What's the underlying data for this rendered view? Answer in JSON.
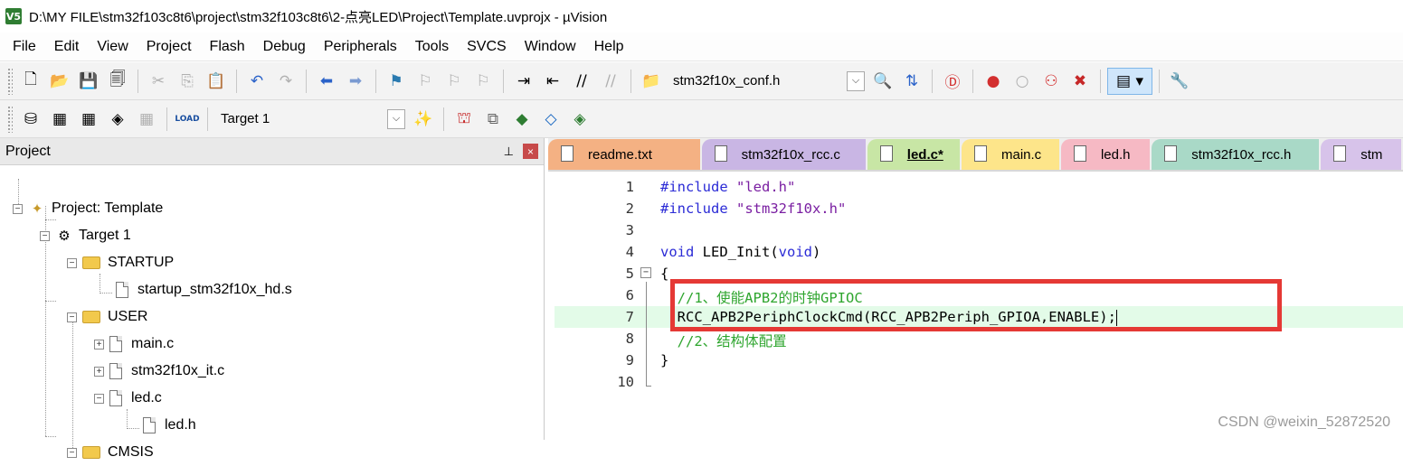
{
  "window": {
    "app_icon": "V5",
    "title": "D:\\MY FILE\\stm32f103c8t6\\project\\stm32f103c8t6\\2-点亮LED\\Project\\Template.uvprojx - µVision"
  },
  "menu": [
    "File",
    "Edit",
    "View",
    "Project",
    "Flash",
    "Debug",
    "Peripherals",
    "Tools",
    "SVCS",
    "Window",
    "Help"
  ],
  "toolbar1": {
    "find_combo_value": "stm32f10x_conf.h"
  },
  "toolbar2": {
    "load_label": "LOAD",
    "target_combo_value": "Target 1"
  },
  "project_panel": {
    "title": "Project",
    "pin_glyph": "ᵠ",
    "close_glyph": "×",
    "tree": [
      {
        "label": "Project: Template",
        "type": "project",
        "expander": "−"
      },
      {
        "label": "Target 1",
        "type": "target",
        "expander": "−"
      },
      {
        "label": "STARTUP",
        "type": "folder",
        "expander": "−"
      },
      {
        "label": "startup_stm32f10x_hd.s",
        "type": "file",
        "expander": ""
      },
      {
        "label": "USER",
        "type": "folder",
        "expander": "−"
      },
      {
        "label": "main.c",
        "type": "file",
        "expander": "+"
      },
      {
        "label": "stm32f10x_it.c",
        "type": "file",
        "expander": "+"
      },
      {
        "label": "led.c",
        "type": "file",
        "expander": "−"
      },
      {
        "label": "led.h",
        "type": "file",
        "expander": ""
      },
      {
        "label": "CMSIS",
        "type": "folder",
        "expander": "−"
      }
    ]
  },
  "tabs": [
    {
      "label": "readme.txt",
      "color": "#f4b183",
      "active": false
    },
    {
      "label": "stm32f10x_rcc.c",
      "color": "#c9b6e4",
      "active": false
    },
    {
      "label": "led.c*",
      "color": "#c8e6a5",
      "active": true
    },
    {
      "label": "main.c",
      "color": "#fde58a",
      "active": false
    },
    {
      "label": "led.h",
      "color": "#f6b9c4",
      "active": false
    },
    {
      "label": "stm32f10x_rcc.h",
      "color": "#a9d9c7",
      "active": false
    },
    {
      "label": "stm",
      "color": "#d7c3ea",
      "active": false
    }
  ],
  "code": {
    "line_numbers": [
      "1",
      "2",
      "3",
      "4",
      "5",
      "6",
      "7",
      "8",
      "9",
      "10"
    ],
    "l1_kw": "#include",
    "l1_str": " \"led.h\"",
    "l2_kw": "#include",
    "l2_str": " \"stm32f10x.h\"",
    "l4_kw1": "void",
    "l4_fn": " LED_Init(",
    "l4_kw2": "void",
    "l4_close": ")",
    "l5": "{",
    "l6": "  //1、使能APB2的时钟GPIOC",
    "l7": "  RCC_APB2PeriphClockCmd(RCC_APB2Periph_GPIOA,ENABLE);",
    "l8": "  //2、结构体配置",
    "l9": "}",
    "fold_glyph": "−"
  },
  "watermark": "CSDN @weixin_52872520",
  "colors": {
    "highlight_box": "#e53935",
    "comment": "#2ea52e",
    "keyword": "#2b2bd6",
    "string": "#7a1fa2"
  }
}
